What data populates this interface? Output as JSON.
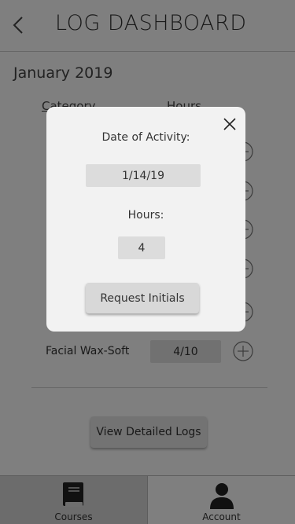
{
  "header": {
    "title": "LOG DASHBOARD",
    "back_icon": "chevron-left-icon"
  },
  "log": {
    "month": "January 2019",
    "columns": {
      "category": "Category",
      "hours": "Hours"
    },
    "visible_row": {
      "category": "Facial Wax-Soft",
      "hours": "4/10"
    },
    "view_button": "View Detailed Logs"
  },
  "tabbar": {
    "tabs": [
      {
        "label": "Courses",
        "icon": "book-icon"
      },
      {
        "label": "Account",
        "icon": "person-icon"
      }
    ]
  },
  "modal": {
    "date_label": "Date of Activity:",
    "date_value": "1/14/19",
    "hours_label": "Hours:",
    "hours_value": "4",
    "request_button": "Request Initials",
    "close_icon": "close-icon"
  },
  "colors": {
    "overlay": "#00000080",
    "modal_bg": "#f2f2f2",
    "field_bg": "#dcdcdc"
  }
}
